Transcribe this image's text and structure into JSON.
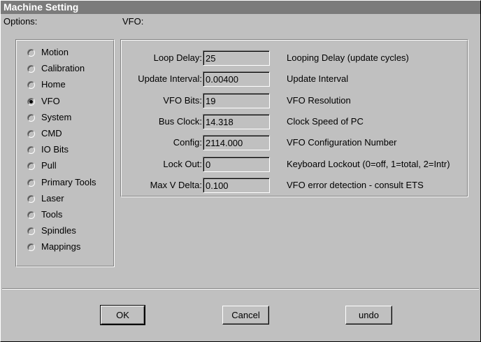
{
  "window": {
    "title": "Machine Setting"
  },
  "options": {
    "header": "Options:",
    "items": [
      {
        "label": "Motion",
        "checked": false
      },
      {
        "label": "Calibration",
        "checked": false
      },
      {
        "label": "Home",
        "checked": false
      },
      {
        "label": "VFO",
        "checked": true
      },
      {
        "label": "System",
        "checked": false
      },
      {
        "label": "CMD",
        "checked": false
      },
      {
        "label": "IO Bits",
        "checked": false
      },
      {
        "label": "Pull",
        "checked": false
      },
      {
        "label": "Primary Tools",
        "checked": false
      },
      {
        "label": "Laser",
        "checked": false
      },
      {
        "label": "Tools",
        "checked": false
      },
      {
        "label": "Spindles",
        "checked": false
      },
      {
        "label": "Mappings",
        "checked": false
      }
    ]
  },
  "vfo": {
    "header": "VFO:",
    "fields": [
      {
        "label": "Loop Delay:",
        "value": "25",
        "desc": "Looping Delay (update cycles)"
      },
      {
        "label": "Update Interval:",
        "value": "0.00400",
        "desc": "Update Interval"
      },
      {
        "label": "VFO Bits:",
        "value": "19",
        "desc": "VFO Resolution"
      },
      {
        "label": "Bus Clock:",
        "value": "14.318",
        "desc": "Clock Speed of PC"
      },
      {
        "label": "Config:",
        "value": "2114.000",
        "desc": "VFO Configuration Number"
      },
      {
        "label": "Lock Out:",
        "value": "0",
        "desc": "Keyboard Lockout (0=off, 1=total, 2=Intr)"
      },
      {
        "label": "Max V Delta:",
        "value": "0.100",
        "desc": "VFO error detection - consult ETS"
      }
    ]
  },
  "buttons": {
    "ok": "OK",
    "cancel": "Cancel",
    "undo": "undo"
  }
}
